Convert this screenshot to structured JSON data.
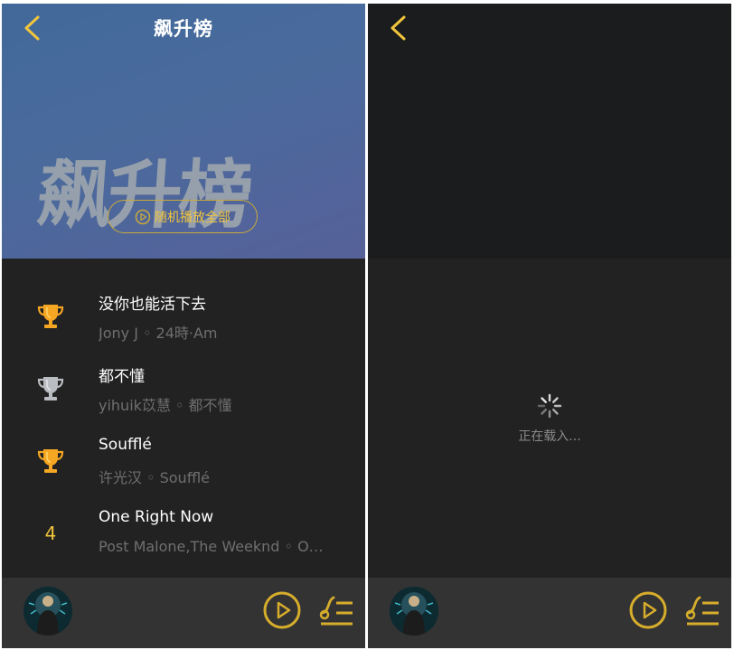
{
  "left": {
    "title": "飙升榜",
    "banner_title": "飙升榜",
    "shuffle_label": "随机播放全部",
    "songs": [
      {
        "rank": "1",
        "rank_style": "trophy-gold",
        "name": "没你也能活下去",
        "meta": "Jony J ◦ 24時·Am"
      },
      {
        "rank": "2",
        "rank_style": "trophy-silver",
        "name": "都不懂",
        "meta": "yihuik苡慧 ◦ 都不懂"
      },
      {
        "rank": "3",
        "rank_style": "trophy-gold",
        "name": "Soufflé",
        "meta": "许光汉 ◦ Soufflé"
      },
      {
        "rank": "4",
        "rank_style": "number",
        "name": "One Right Now",
        "meta": "Post Malone,The Weeknd ◦ One Right Now"
      }
    ]
  },
  "right": {
    "loading_text": "正在载入..."
  },
  "colors": {
    "accent": "#f1c53b",
    "panel_bg": "#222222",
    "player_bg": "#333333",
    "banner_blue": "#4a6a9c"
  },
  "icons": {
    "back": "chevron-left-icon",
    "rank1": "gold-trophy-icon",
    "rank2": "silver-trophy-icon",
    "rank3": "gold-trophy-icon",
    "play": "play-circle-icon",
    "playlist": "playlist-icon",
    "loading": "spinner-icon"
  }
}
